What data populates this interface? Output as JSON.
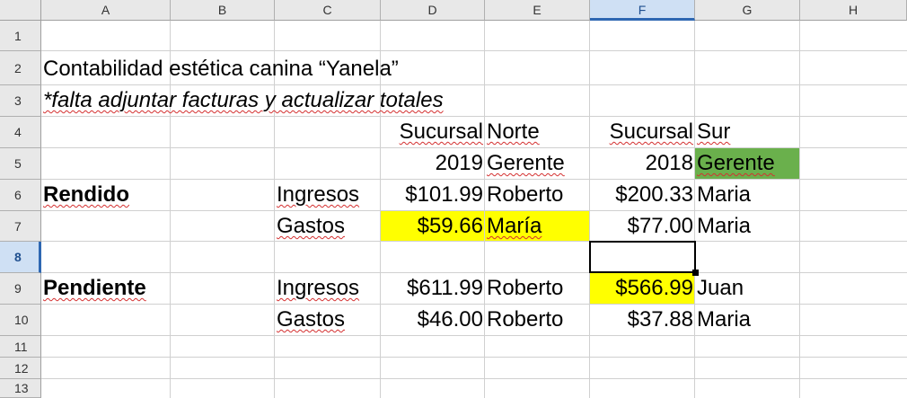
{
  "columns": [
    "A",
    "B",
    "C",
    "D",
    "E",
    "F",
    "G",
    "H"
  ],
  "selected_column": "F",
  "rows": [
    "1",
    "2",
    "3",
    "4",
    "5",
    "6",
    "7",
    "8",
    "9",
    "10",
    "11",
    "12",
    "13"
  ],
  "selected_row": "8",
  "cells": {
    "A2": "Contabilidad estética canina “Yanela”",
    "A3": "*falta adjuntar facturas y actualizar totales",
    "D4": "Sucursal",
    "E4": "Norte",
    "F4": "Sucursal",
    "G4": "Sur",
    "D5": "2019",
    "E5": "Gerente",
    "F5": "2018",
    "G5": "Gerente",
    "A6": "Rendido",
    "C6": "Ingresos",
    "D6": "$101.99",
    "E6": "Roberto",
    "F6": "$200.33",
    "G6": "Maria",
    "C7": "Gastos",
    "D7": "$59.66",
    "E7": "María",
    "F7": "$77.00",
    "G7": "Maria",
    "A9": "Pendiente",
    "C9": "Ingresos",
    "D9": "$611.99",
    "E9": "Roberto",
    "F9": "$566.99",
    "G9": "Juan",
    "C10": "Gastos",
    "D10": "$46.00",
    "E10": "Roberto",
    "F10": "$37.88",
    "G10": "Maria"
  },
  "fills": {
    "yellow": "#ffff00",
    "green": "#6ab04c",
    "selection": "#2e67b2"
  },
  "active_cell": "F8"
}
